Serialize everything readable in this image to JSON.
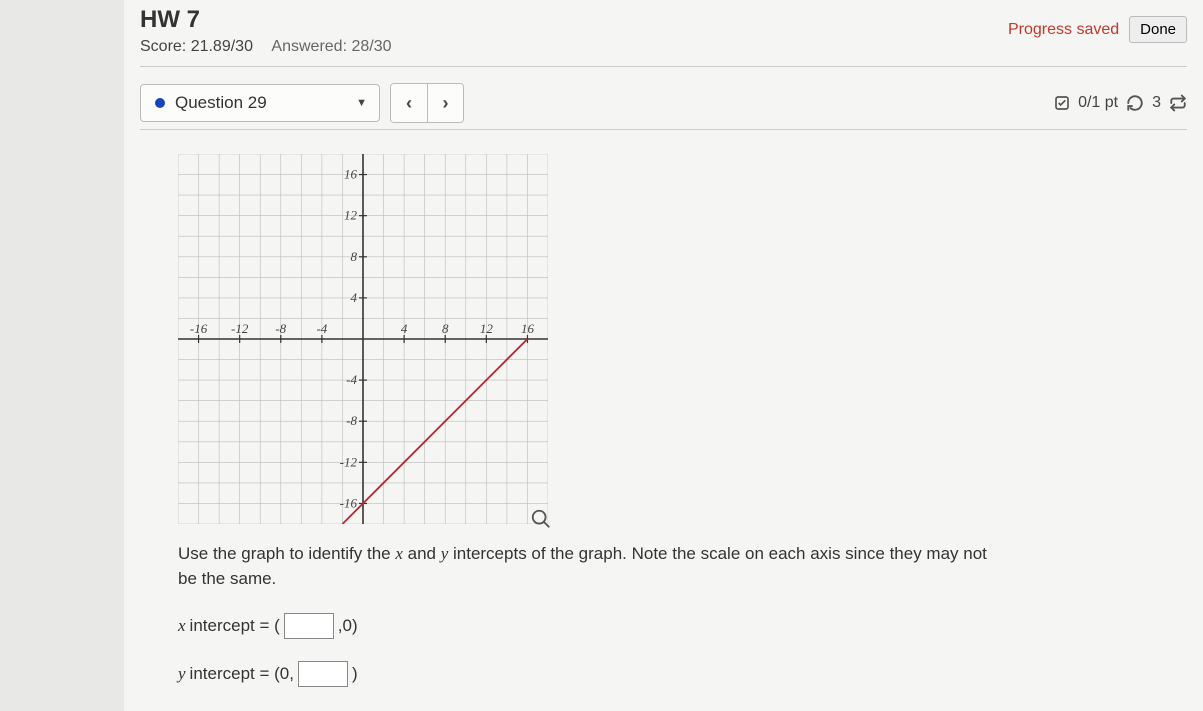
{
  "header": {
    "title": "HW 7",
    "score_label": "Score: 21.89/30",
    "answered_label": "Answered: 28/30",
    "progress_saved": "Progress saved",
    "done_label": "Done"
  },
  "qbar": {
    "question_label": "Question 29",
    "prev_glyph": "‹",
    "next_glyph": "›",
    "points": "0/1 pt",
    "retry_count": "3"
  },
  "chart_data": {
    "type": "line",
    "title": "",
    "xlabel": "",
    "ylabel": "",
    "x": [
      -2,
      16
    ],
    "y": [
      -18,
      0
    ],
    "xlim": [
      -18,
      18
    ],
    "ylim": [
      -18,
      18
    ],
    "xticks": [
      -16,
      -12,
      -8,
      -4,
      4,
      8,
      12,
      16
    ],
    "yticks": [
      -16,
      -12,
      -8,
      -4,
      4,
      8,
      12,
      16
    ],
    "grid": true
  },
  "prompt": {
    "pre": "Use the graph to identify the ",
    "varx": "x",
    "mid1": " and ",
    "vary": "y",
    "post": " intercepts of the graph. Note the scale on each axis since they may not be the same."
  },
  "inputs": {
    "x_label_var": "x",
    "x_label_rest": " intercept = (",
    "x_suffix": ",0)",
    "y_label_var": "y",
    "y_label_rest": " intercept = (0,",
    "y_suffix": ")",
    "x_value": "",
    "y_value": ""
  }
}
